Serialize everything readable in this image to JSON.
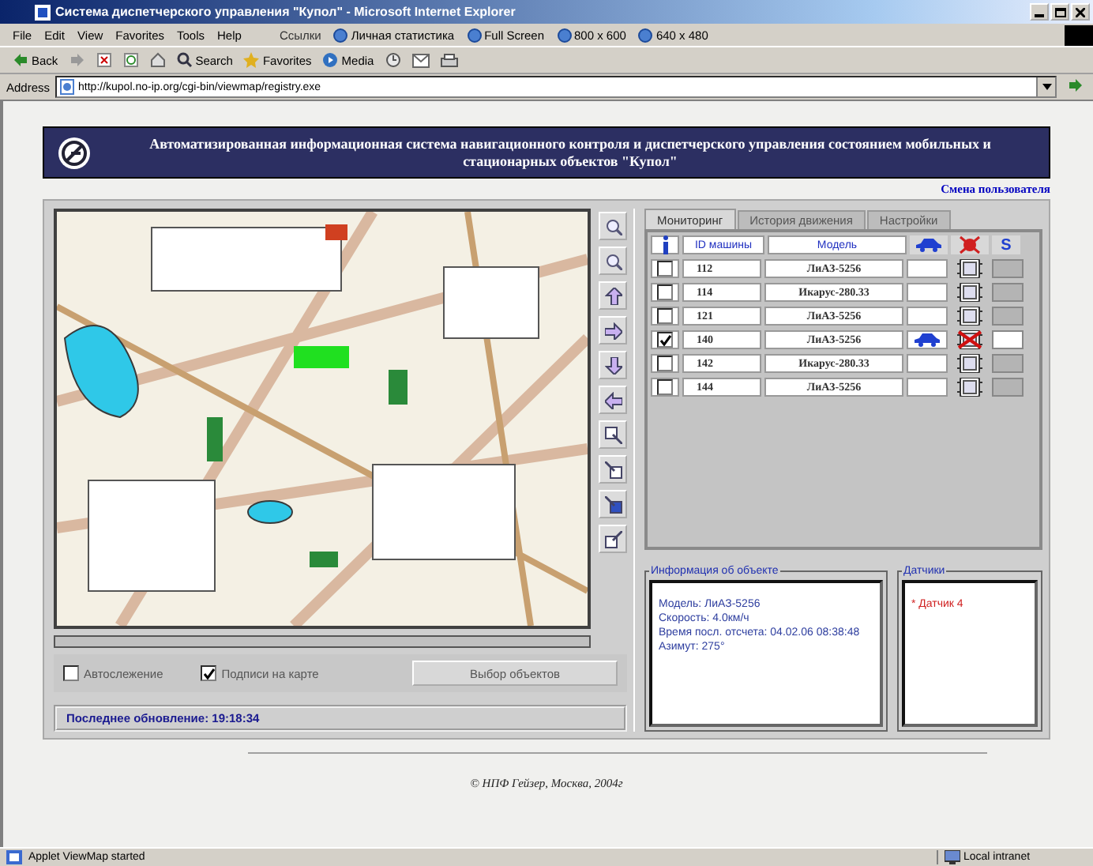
{
  "window": {
    "title": "Система диспетчерского управления \"Купол\" - Microsoft Internet Explorer"
  },
  "menu": [
    "File",
    "Edit",
    "View",
    "Favorites",
    "Tools",
    "Help"
  ],
  "links": {
    "label": "Ссылки",
    "items": [
      "Личная статистика",
      "Full Screen",
      "800 x 600",
      "640 x 480"
    ]
  },
  "toolbar": [
    "Back",
    "Search",
    "Favorites",
    "Media"
  ],
  "address": {
    "label": "Address",
    "value": "http://kupol.no-ip.org/cgi-bin/viewmap/registry.exe"
  },
  "header": {
    "title": "Автоматизированная информационная система навигационного контроля и диспетчерского управления состоянием мобильных и стационарных объектов \"Купол\"",
    "user_link": "Смена пользователя"
  },
  "tabs": [
    {
      "label": "Мониторинг",
      "selected": true
    },
    {
      "label": "История движения",
      "selected": false
    },
    {
      "label": "Настройки",
      "selected": false
    }
  ],
  "table": {
    "columns": [
      "ID машины",
      "Модель",
      "S"
    ],
    "rows": [
      {
        "id": "112",
        "model": "ЛиАЗ-5256",
        "checked": false,
        "car": false,
        "alarm": false,
        "s_on": false
      },
      {
        "id": "114",
        "model": "Икарус-280.33",
        "checked": false,
        "car": false,
        "alarm": false,
        "s_on": false
      },
      {
        "id": "121",
        "model": "ЛиАЗ-5256",
        "checked": false,
        "car": false,
        "alarm": false,
        "s_on": false
      },
      {
        "id": "140",
        "model": "ЛиАЗ-5256",
        "checked": true,
        "car": true,
        "alarm": true,
        "s_on": true
      },
      {
        "id": "142",
        "model": "Икарус-280.33",
        "checked": false,
        "car": false,
        "alarm": false,
        "s_on": false
      },
      {
        "id": "144",
        "model": "ЛиАЗ-5256",
        "checked": false,
        "car": false,
        "alarm": false,
        "s_on": false
      }
    ]
  },
  "info": {
    "title": "Информация об объекте",
    "lines": [
      "Модель: ЛиАЗ-5256",
      "Скорость: 4.0км/ч",
      "Время посл. отсчета: 04.02.06 08:38:48",
      "Азимут: 275°"
    ]
  },
  "sensors": {
    "title": "Датчики",
    "items": [
      "* Датчик 4"
    ]
  },
  "options": [
    {
      "label": "Автослежение",
      "checked": false
    },
    {
      "label": "Подписи на карте",
      "checked": true
    }
  ],
  "select_button": "Выбор объектов",
  "last_update": "Последнее обновление: 19:18:34",
  "footer": "© НПФ Гейзер, Москва, 2004г",
  "status_bar": {
    "text": "Applet ViewMap started",
    "zone": "Local intranet"
  }
}
